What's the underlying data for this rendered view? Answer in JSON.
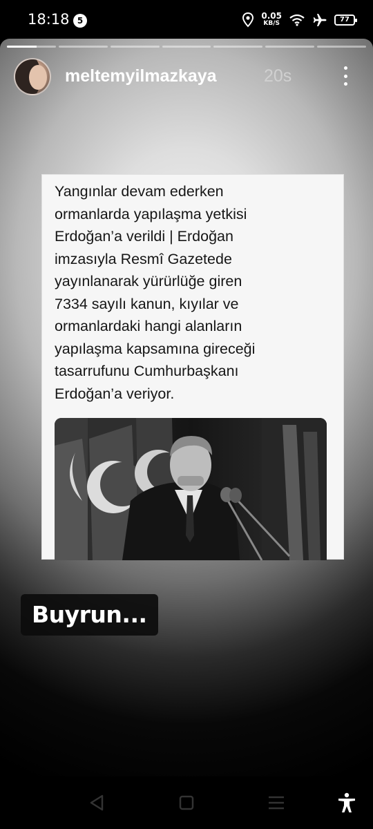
{
  "status_bar": {
    "time": "18:18",
    "notification_count": "5",
    "net_speed_value": "0.05",
    "net_speed_unit": "KB/S",
    "battery": "77",
    "icons": [
      "location-icon",
      "wifi-icon",
      "airplane-icon",
      "battery-icon"
    ]
  },
  "story": {
    "progress_segments": 7,
    "active_segment_progress": 0.6,
    "username": "meltemyilmazkaya",
    "time_ago": "20s",
    "post_text": "Yangınlar devam ederken\normanlarda yapılaşma yetkisi\nErdoğan’a verildi | Erdoğan\nimzasıyla Resmî Gazetede\nyayınlanarak yürürlüğe giren\n7334 sayılı kanun, kıyılar ve\normanlardaki hangi alanların\nyapılaşma kapsamına gireceği\ntasarrufunu Cumhurbaşkanı\nErdoğan’a veriyor.",
    "caption": "Buyrun..."
  },
  "nav_bar": {
    "icons": [
      "back-icon",
      "home-icon",
      "recents-icon",
      "accessibility-icon"
    ]
  },
  "colors": {
    "status_bar_bg": "#000000",
    "text_primary": "#ffffff",
    "card_bg": "#f6f6f6",
    "caption_bg": "#0c0c0c"
  }
}
